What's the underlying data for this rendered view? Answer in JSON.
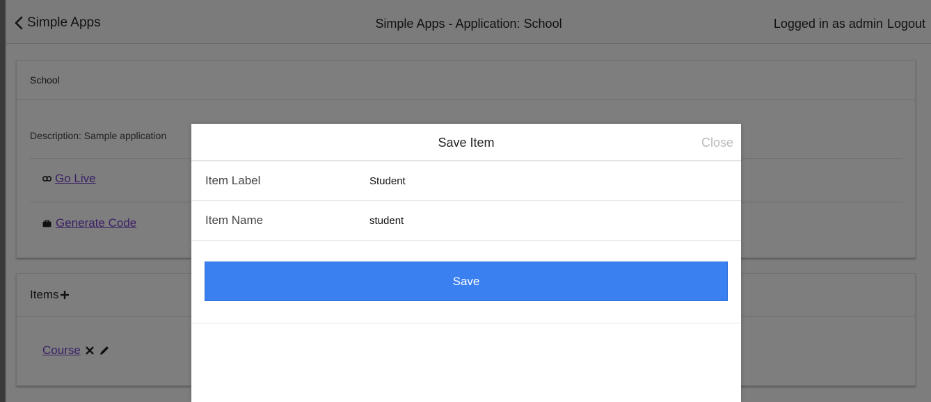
{
  "navbar": {
    "back_label": "Simple Apps",
    "title": "Simple Apps - Application: School",
    "logged_in": "Logged in as admin",
    "logout": "Logout"
  },
  "app_card": {
    "name": "School",
    "description": "Description: Sample application",
    "go_live": "Go Live",
    "generate_code": "Generate Code"
  },
  "items_card": {
    "title": "Items",
    "items": [
      {
        "label": "Course"
      }
    ]
  },
  "modal": {
    "title": "Save Item",
    "close": "Close",
    "fields": [
      {
        "label": "Item Label",
        "value": "Student"
      },
      {
        "label": "Item Name",
        "value": "student"
      }
    ],
    "save_label": "Save"
  },
  "colors": {
    "overlay": "#7d7d7d",
    "save_button": "#3a80f1",
    "link": "#3a1f66"
  }
}
